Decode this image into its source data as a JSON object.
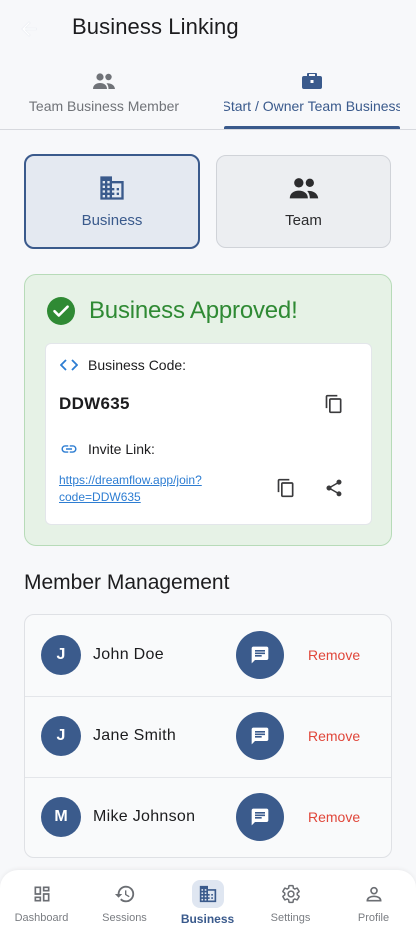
{
  "header": {
    "title": "Business Linking"
  },
  "tabs": [
    {
      "label": "Team Business Member",
      "icon": "group-icon",
      "active": false
    },
    {
      "label": "Start / Owner Team Business",
      "icon": "briefcase-icon",
      "active": true
    }
  ],
  "segments": {
    "business": {
      "label": "Business",
      "icon": "building-icon",
      "selected": true
    },
    "team": {
      "label": "Team",
      "icon": "group-icon",
      "selected": false
    }
  },
  "approved": {
    "title": "Business Approved!",
    "code_label": "Business Code:",
    "code_value": "DDW635",
    "invite_label": "Invite Link:",
    "invite_url": "https://dreamflow.app/join?code=DDW635"
  },
  "members": {
    "title": "Member Management",
    "remove_label": "Remove",
    "items": [
      {
        "initial": "J",
        "name": "John Doe"
      },
      {
        "initial": "J",
        "name": "Jane Smith"
      },
      {
        "initial": "M",
        "name": "Mike Johnson"
      }
    ]
  },
  "nav": [
    {
      "label": "Dashboard",
      "icon": "dashboard-icon",
      "active": false
    },
    {
      "label": "Sessions",
      "icon": "history-icon",
      "active": false
    },
    {
      "label": "Business",
      "icon": "building-icon",
      "active": true
    },
    {
      "label": "Settings",
      "icon": "gear-icon",
      "active": false
    },
    {
      "label": "Profile",
      "icon": "person-icon",
      "active": false
    }
  ],
  "colors": {
    "primary": "#3a5a8c",
    "success": "#2f8a34",
    "danger": "#e0463a",
    "link": "#2d7dd2"
  }
}
